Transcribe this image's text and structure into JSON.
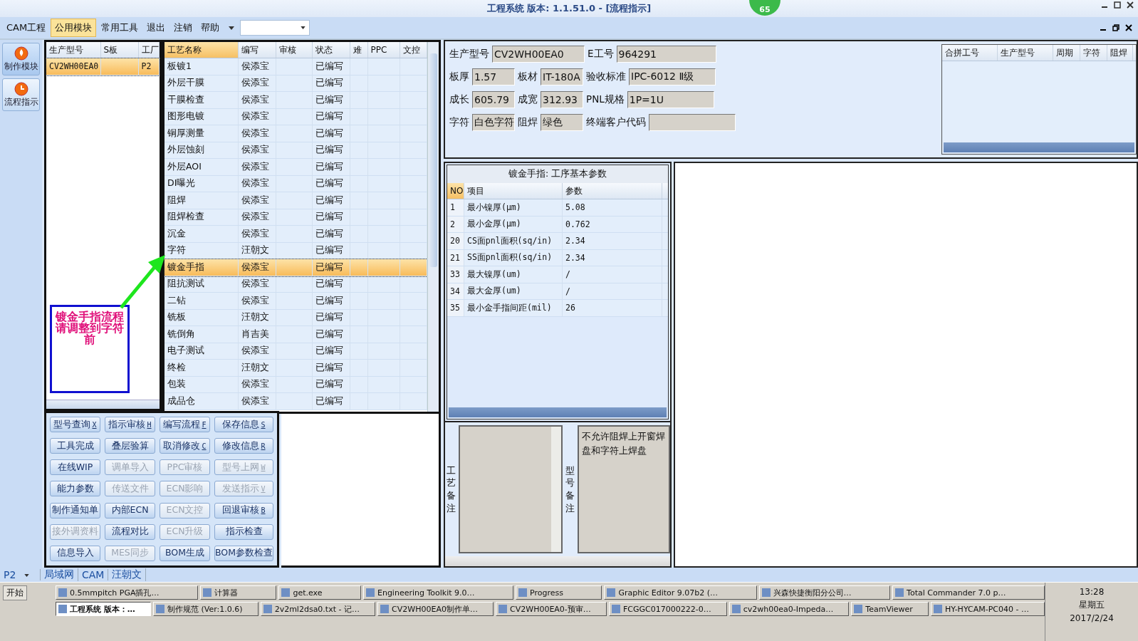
{
  "window": {
    "title": "工程系统  版本: 1.1.51.0 - [流程指示]",
    "badge": "65"
  },
  "menu": [
    {
      "label": "CAM工程",
      "selected": false
    },
    {
      "label": "公用模块",
      "selected": true
    },
    {
      "label": "常用工具",
      "selected": false
    },
    {
      "label": "退出",
      "selected": false
    },
    {
      "label": "注销",
      "selected": false
    },
    {
      "label": "帮助",
      "selected": false
    }
  ],
  "nav": [
    {
      "label": "制作模块",
      "selected": true
    },
    {
      "label": "流程指示",
      "selected": false
    }
  ],
  "product_list": {
    "columns": [
      "生产型号",
      "S板",
      "工厂"
    ],
    "rows": [
      {
        "cells": [
          "CV2WH00EA0",
          "",
          "P2"
        ],
        "selected": true
      }
    ]
  },
  "annotation": {
    "text": "镀金手指流程请调整到字符前"
  },
  "process_table": {
    "columns": [
      "工艺名称",
      "编写",
      "审核",
      "状态",
      "难",
      "PPC",
      "文控"
    ],
    "rows": [
      {
        "name": "板镀1",
        "writer": "侯添宝",
        "status": "已编写",
        "selected": false
      },
      {
        "name": "外层干膜",
        "writer": "侯添宝",
        "status": "已编写",
        "selected": false
      },
      {
        "name": "干膜检查",
        "writer": "侯添宝",
        "status": "已编写",
        "selected": false
      },
      {
        "name": "图形电镀",
        "writer": "侯添宝",
        "status": "已编写",
        "selected": false
      },
      {
        "name": "铜厚测量",
        "writer": "侯添宝",
        "status": "已编写",
        "selected": false
      },
      {
        "name": "外层蚀刻",
        "writer": "侯添宝",
        "status": "已编写",
        "selected": false
      },
      {
        "name": "外层AOI",
        "writer": "侯添宝",
        "status": "已编写",
        "selected": false
      },
      {
        "name": "DI曝光",
        "writer": "侯添宝",
        "status": "已编写",
        "selected": false
      },
      {
        "name": "阻焊",
        "writer": "侯添宝",
        "status": "已编写",
        "selected": false
      },
      {
        "name": "阻焊检查",
        "writer": "侯添宝",
        "status": "已编写",
        "selected": false
      },
      {
        "name": "沉金",
        "writer": "侯添宝",
        "status": "已编写",
        "selected": false
      },
      {
        "name": "字符",
        "writer": "汪朝文",
        "status": "已编写",
        "selected": false
      },
      {
        "name": "镀金手指",
        "writer": "侯添宝",
        "status": "已编写",
        "selected": true
      },
      {
        "name": "阻抗测试",
        "writer": "侯添宝",
        "status": "已编写",
        "selected": false
      },
      {
        "name": "二钻",
        "writer": "侯添宝",
        "status": "已编写",
        "selected": false
      },
      {
        "name": "铣板",
        "writer": "汪朝文",
        "status": "已编写",
        "selected": false
      },
      {
        "name": "铣倒角",
        "writer": "肖吉美",
        "status": "已编写",
        "selected": false
      },
      {
        "name": "电子测试",
        "writer": "侯添宝",
        "status": "已编写",
        "selected": false
      },
      {
        "name": "终检",
        "writer": "汪朝文",
        "status": "已编写",
        "selected": false
      },
      {
        "name": "包装",
        "writer": "侯添宝",
        "status": "已编写",
        "selected": false
      },
      {
        "name": "成品仓",
        "writer": "侯添宝",
        "status": "已编写",
        "selected": false
      }
    ]
  },
  "buttons": [
    {
      "label": "型号查询",
      "key": "X",
      "disabled": false
    },
    {
      "label": "指示审核",
      "key": "H",
      "disabled": false
    },
    {
      "label": "编写流程",
      "key": "F",
      "disabled": false
    },
    {
      "label": "保存信息",
      "key": "S",
      "disabled": false
    },
    {
      "label": "工具完成",
      "disabled": false
    },
    {
      "label": "叠层验算",
      "disabled": false
    },
    {
      "label": "取消修改",
      "key": "C",
      "disabled": false
    },
    {
      "label": "修改信息",
      "key": "R",
      "disabled": false
    },
    {
      "label": "在线WIP",
      "disabled": false
    },
    {
      "label": "调单导入",
      "disabled": true
    },
    {
      "label": "PPC审核",
      "disabled": true
    },
    {
      "label": "型号上网",
      "key": "W",
      "disabled": true
    },
    {
      "label": "能力参数",
      "disabled": false
    },
    {
      "label": "传送文件",
      "disabled": true
    },
    {
      "label": "ECN影响",
      "disabled": true
    },
    {
      "label": "发送指示",
      "key": "V",
      "disabled": true
    },
    {
      "label": "制作通知单",
      "disabled": false
    },
    {
      "label": "内部ECN",
      "disabled": false
    },
    {
      "label": "ECN文控",
      "disabled": true
    },
    {
      "label": "回退审核",
      "key": "B",
      "disabled": false
    },
    {
      "label": "接外调资料",
      "disabled": true
    },
    {
      "label": "流程对比",
      "disabled": false
    },
    {
      "label": "ECN升级",
      "disabled": true
    },
    {
      "label": "指示检查",
      "disabled": false
    },
    {
      "label": "信息导入",
      "disabled": false
    },
    {
      "label": "MES同步",
      "disabled": true
    },
    {
      "label": "BOM生成",
      "disabled": false
    },
    {
      "label": "BOM参数检查",
      "disabled": false
    }
  ],
  "info_rows": [
    [
      {
        "label": "生产型号",
        "value": "CV2WH00EA0"
      },
      {
        "label": "E工号",
        "value": "964291"
      }
    ],
    [
      {
        "label": "板厚",
        "value": "1.57"
      },
      {
        "label": "板材",
        "value": "IT-180A"
      },
      {
        "label": "验收标准",
        "value": "IPC-6012 Ⅱ级"
      }
    ],
    [
      {
        "label": "成长",
        "value": "605.79"
      },
      {
        "label": "成宽",
        "value": "312.93"
      },
      {
        "label": "PNL规格",
        "value": "1P=1U"
      }
    ],
    [
      {
        "label": "字符",
        "value": "白色字符"
      },
      {
        "label": "阻焊",
        "value": "绿色"
      },
      {
        "label": "终端客户代码"
      }
    ]
  ],
  "merge_table": {
    "columns": [
      "合拼工号",
      "生产型号",
      "周期",
      "字符",
      "阻焊"
    ]
  },
  "params": {
    "title": "镀金手指: 工序基本参数",
    "columns": [
      "NO",
      "项目",
      "参数"
    ],
    "rows": [
      [
        "1",
        "最小镍厚(μm)",
        "5.08"
      ],
      [
        "2",
        "最小金厚(μm)",
        "0.762"
      ],
      [
        "20",
        "CS面pnl面积(sq/in)",
        "2.34"
      ],
      [
        "21",
        "SS面pnl面积(sq/in)",
        "2.34"
      ],
      [
        "33",
        "最大镍厚(um)",
        "/"
      ],
      [
        "34",
        "最大金厚(um)",
        "/"
      ],
      [
        "35",
        "最小金手指间距(mil)",
        "26"
      ]
    ]
  },
  "remarks": {
    "process_label": "工艺备注",
    "model_label": "型号备注",
    "model_text": "不允许阻焊上开窗焊盘和字符上焊盘"
  },
  "status_bar": {
    "site": "P2",
    "items": [
      "局域网",
      "CAM",
      "汪朝文"
    ]
  },
  "taskbar": {
    "start": "开始",
    "row1": [
      {
        "label": "0.5mmpitch PGA插孔…",
        "active": false
      },
      {
        "label": "计算器",
        "active": false
      },
      {
        "label": "get.exe",
        "active": false
      },
      {
        "label": "Engineering Toolkit 9.0…",
        "active": false
      },
      {
        "label": "Progress",
        "active": false
      },
      {
        "label": "Graphic Editor 9.07b2 (…",
        "active": false
      },
      {
        "label": "兴森快捷衡阳分公司…",
        "active": false
      },
      {
        "label": "Total Commander 7.0 p…",
        "active": false
      }
    ],
    "row2": [
      {
        "label": "工程系统  版本：…",
        "active": true
      },
      {
        "label": "制作规范 (Ver:1.0.6)",
        "active": false
      },
      {
        "label": "2v2ml2dsa0.txt - 记…",
        "active": false
      },
      {
        "label": "CV2WH00EA0制作单…",
        "active": false
      },
      {
        "label": "CV2WH00EA0-预审…",
        "active": false
      },
      {
        "label": "FCGGC017000222-0…",
        "active": false
      },
      {
        "label": "cv2wh00ea0-Impeda…",
        "active": false
      },
      {
        "label": "TeamViewer",
        "active": false
      },
      {
        "label": "HY-HYCAM-PC040 - …",
        "active": false
      }
    ],
    "time": "13:28",
    "weekday": "星期五",
    "date": "2017/2/24"
  }
}
